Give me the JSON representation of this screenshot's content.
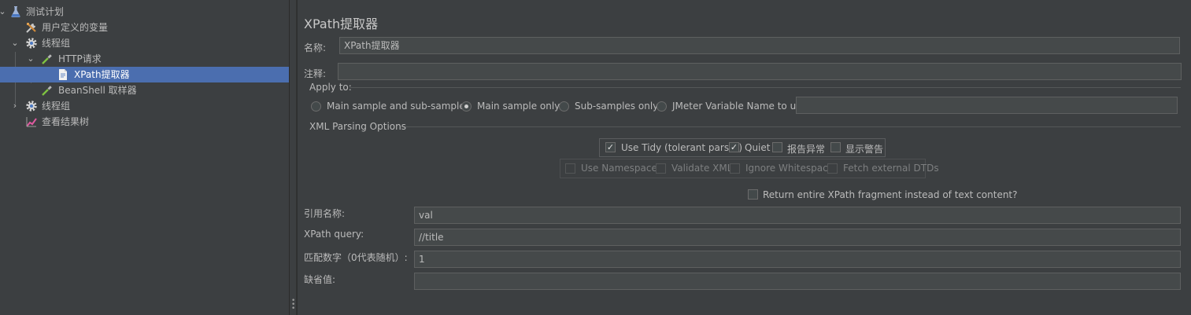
{
  "tree": {
    "items": [
      {
        "label": "测试计划",
        "icon": "test-plan-flask-icon"
      },
      {
        "label": "用户定义的变量",
        "icon": "tools-icon"
      },
      {
        "label": "线程组",
        "icon": "gear-icon"
      },
      {
        "label": "HTTP请求",
        "icon": "pipette-icon"
      },
      {
        "label": "XPath提取器",
        "icon": "document-icon"
      },
      {
        "label": "BeanShell 取样器",
        "icon": "pipette-icon"
      },
      {
        "label": "线程组",
        "icon": "gear-icon"
      },
      {
        "label": "查看结果树",
        "icon": "chart-icon"
      }
    ],
    "selected_index": 4
  },
  "panel": {
    "title": "XPath提取器",
    "name_label": "名称:",
    "name_value": "XPath提取器",
    "comment_label": "注释:",
    "comment_value": "",
    "apply_to": {
      "legend": "Apply to:",
      "options": [
        "Main sample and sub-samples",
        "Main sample only",
        "Sub-samples only",
        "JMeter Variable Name to use"
      ],
      "selected": "Main sample only",
      "variable_value": ""
    },
    "xml_options": {
      "legend": "XML Parsing Options",
      "use_tidy": {
        "label": "Use Tidy (tolerant parser)",
        "checked": true
      },
      "quiet": {
        "label": "Quiet",
        "checked": true
      },
      "report_errors": {
        "label": "报告异常",
        "checked": false
      },
      "show_warnings": {
        "label": "显示警告",
        "checked": false
      },
      "use_namespaces": {
        "label": "Use Namespaces",
        "checked": false
      },
      "validate_xml": {
        "label": "Validate XML",
        "checked": false
      },
      "ignore_whitespace": {
        "label": "Ignore Whitespace",
        "checked": false
      },
      "fetch_dtds": {
        "label": "Fetch external DTDs",
        "checked": false
      },
      "return_fragment": {
        "label": "Return entire XPath fragment instead of text content?",
        "checked": false
      }
    },
    "ref_name_label": "引用名称:",
    "ref_name_value": "val",
    "xpath_label": "XPath query:",
    "xpath_value": "//title",
    "match_no_label": "匹配数字（0代表随机）:",
    "match_no_value": "1",
    "default_label": "缺省值:",
    "default_value": ""
  }
}
